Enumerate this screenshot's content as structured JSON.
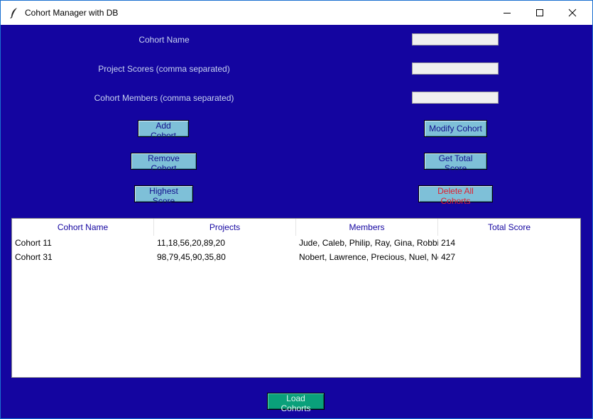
{
  "window": {
    "title": "Cohort Manager with DB"
  },
  "form": {
    "cohort_name_label": "Cohort Name",
    "cohort_name_value": "",
    "project_scores_label": "Project Scores (comma separated)",
    "project_scores_value": "",
    "members_label": "Cohort Members (comma separated)",
    "members_value": ""
  },
  "buttons": {
    "add": "Add Cohort",
    "modify": "Modify Cohort",
    "remove": "Remove Cohort",
    "total": "Get Total Score",
    "highest": "Highest Score",
    "delete_all": "Delete All Cohorts",
    "load": "Load Cohorts"
  },
  "table": {
    "columns": [
      "Cohort Name",
      "Projects",
      "Members",
      "Total Score"
    ],
    "rows": [
      [
        "Cohort 11",
        "11,18,56,20,89,20",
        "Jude, Caleb, Philip, Ray, Gina, Robbins",
        "214"
      ],
      [
        "Cohort 31",
        "98,79,45,90,35,80",
        "Nobert, Lawrence, Precious, Nuel, Ne",
        "427"
      ]
    ]
  },
  "colors": {
    "background": "#1405a0",
    "button": "#7ec0d8",
    "load_button": "#0aa07a",
    "danger_text": "#e0202e"
  }
}
